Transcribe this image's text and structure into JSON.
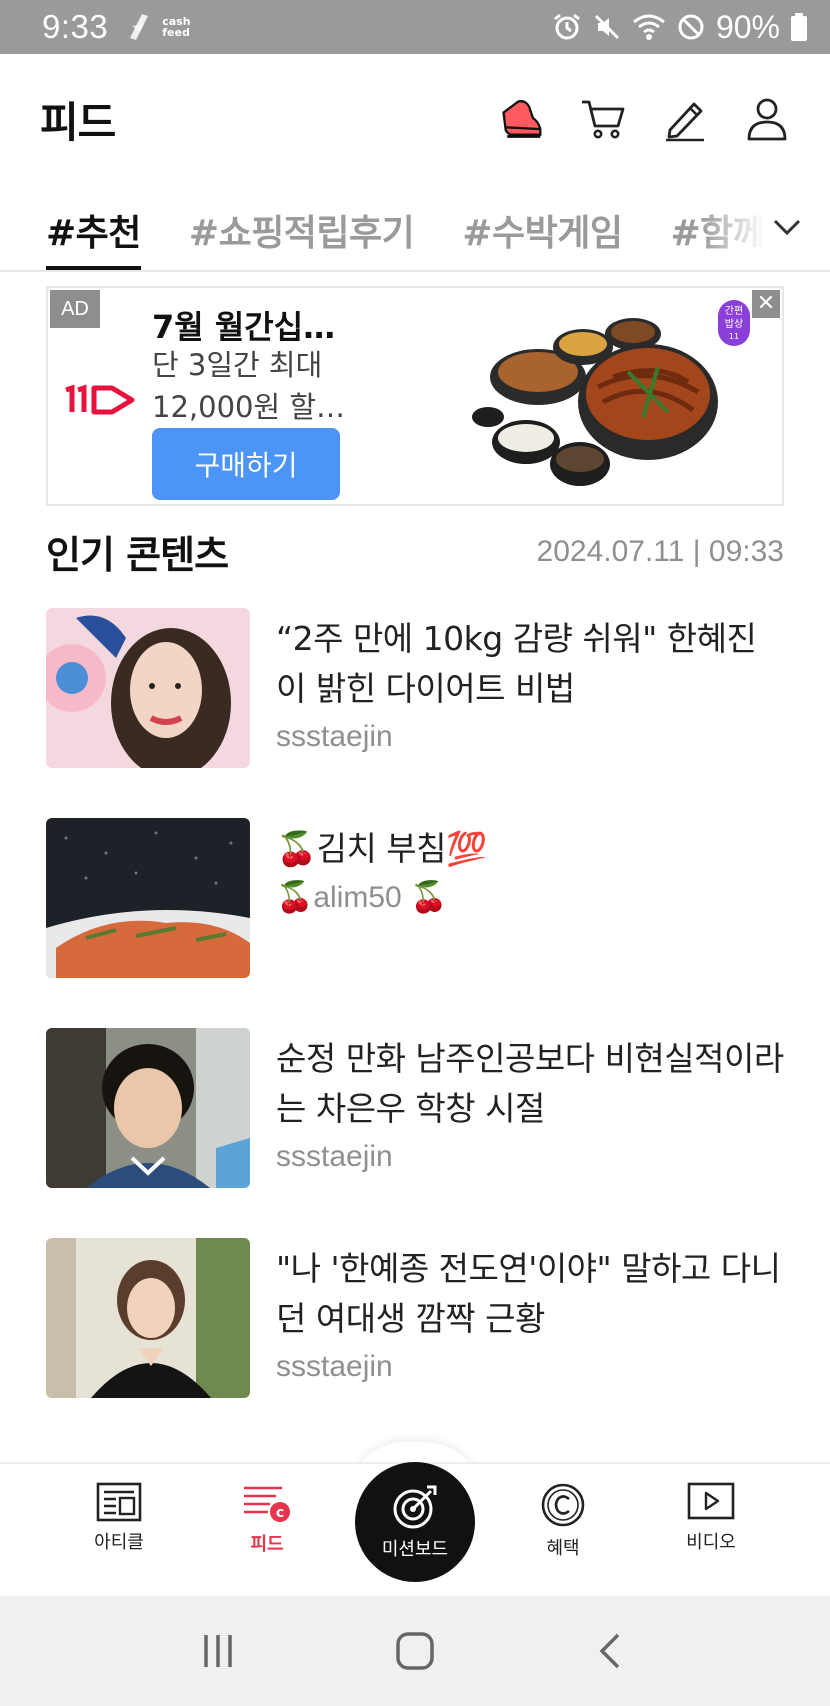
{
  "status_bar": {
    "time": "9:33",
    "app_badge_line1": "cash",
    "app_badge_line2": "feed",
    "battery": "90%"
  },
  "header": {
    "title": "피드",
    "icons": [
      "reward-shoe-icon",
      "cart-icon",
      "pencil-icon",
      "user-icon"
    ]
  },
  "tabs": [
    {
      "label": "#추천",
      "active": true
    },
    {
      "label": "#쇼핑적립후기",
      "active": false
    },
    {
      "label": "#수박게임",
      "active": false
    },
    {
      "label": "#함께걷기",
      "active": false
    }
  ],
  "ad": {
    "badge": "AD",
    "close": "✕",
    "logo_text": "11",
    "title": "7월 월간십…",
    "desc_line1": "단 3일간 최대",
    "desc_line2": "12,000원 할…",
    "button": "구매하기",
    "image_tag_line1": "간편",
    "image_tag_line2": "밥상",
    "image_tag_line3": "11"
  },
  "popular": {
    "title": "인기 콘텐츠",
    "timestamp": "2024.07.11 | 09:33",
    "items": [
      {
        "title": "“2주 만에 10kg 감량 쉬워\" 한혜진이 밝힌 다이어트 비법",
        "author": "ssstaejin"
      },
      {
        "title": "🍒김치 부침💯",
        "author": "🍒alim50 🍒"
      },
      {
        "title": "순정 만화 남주인공보다 비현실적이라는 차은우 학창 시절",
        "author": "ssstaejin"
      },
      {
        "title": "\"나 '한예종 전도연'이야\" 말하고 다니던 여대생 깜짝 근황",
        "author": "ssstaejin"
      }
    ]
  },
  "bottom_nav": {
    "article": "아티클",
    "feed": "피드",
    "mission": "미션보드",
    "benefit": "혜택",
    "video": "비디오"
  },
  "colors": {
    "accent": "#e5344b",
    "ad_button": "#4d94f7",
    "status_bar": "#9a9a9a"
  }
}
